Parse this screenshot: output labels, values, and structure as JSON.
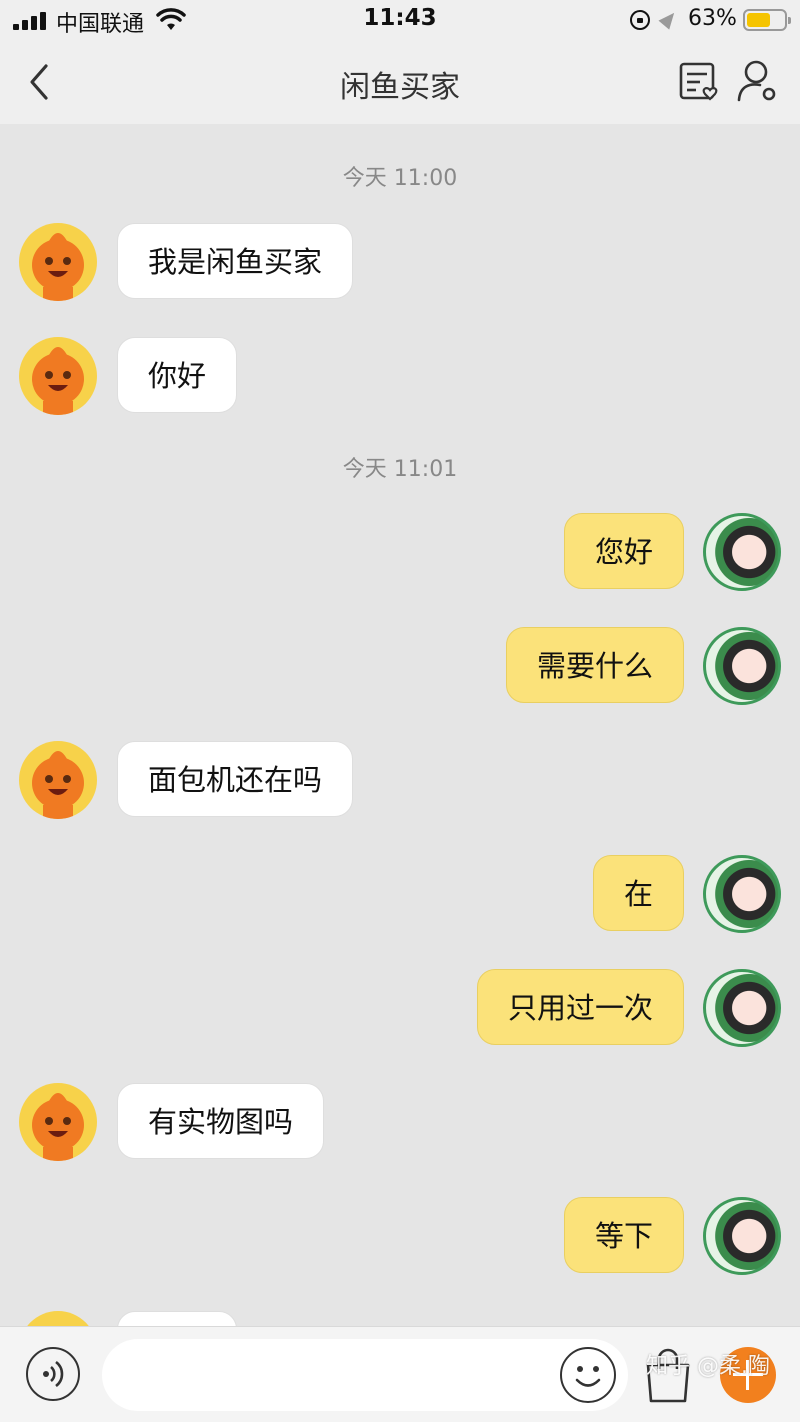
{
  "status_bar": {
    "carrier": "中国联通",
    "time": "11:43",
    "battery_percent": "63%",
    "battery_level": 0.63
  },
  "nav": {
    "title": "闲鱼买家",
    "back_icon": "chevron-left-icon",
    "order_icon": "order-list-icon",
    "profile_icon": "user-settings-icon"
  },
  "messages": [
    {
      "type": "timestamp",
      "text": "今天 11:00"
    },
    {
      "type": "bubble",
      "side": "left",
      "text": "我是闲鱼买家"
    },
    {
      "type": "bubble",
      "side": "left",
      "text": "你好"
    },
    {
      "type": "timestamp",
      "text": "今天 11:01"
    },
    {
      "type": "bubble",
      "side": "right",
      "text": "您好"
    },
    {
      "type": "bubble",
      "side": "right",
      "text": "需要什么"
    },
    {
      "type": "bubble",
      "side": "left",
      "text": "面包机还在吗"
    },
    {
      "type": "bubble",
      "side": "right",
      "text": "在"
    },
    {
      "type": "bubble",
      "side": "right",
      "text": "只用过一次"
    },
    {
      "type": "bubble",
      "side": "left",
      "text": "有实物图吗"
    },
    {
      "type": "bubble",
      "side": "right",
      "text": "等下"
    }
  ],
  "input_bar": {
    "placeholder": "",
    "voice_icon": "voice-icon",
    "emoji_icon": "emoji-icon",
    "bag_icon": "shopping-bag-icon",
    "plus_icon": "plus-icon"
  },
  "watermark": "知乎 @柔.陶",
  "colors": {
    "background": "#e5e5e5",
    "buyer_bubble": "#ffffff",
    "self_bubble": "#fbe27a",
    "accent_orange": "#f2801e"
  }
}
